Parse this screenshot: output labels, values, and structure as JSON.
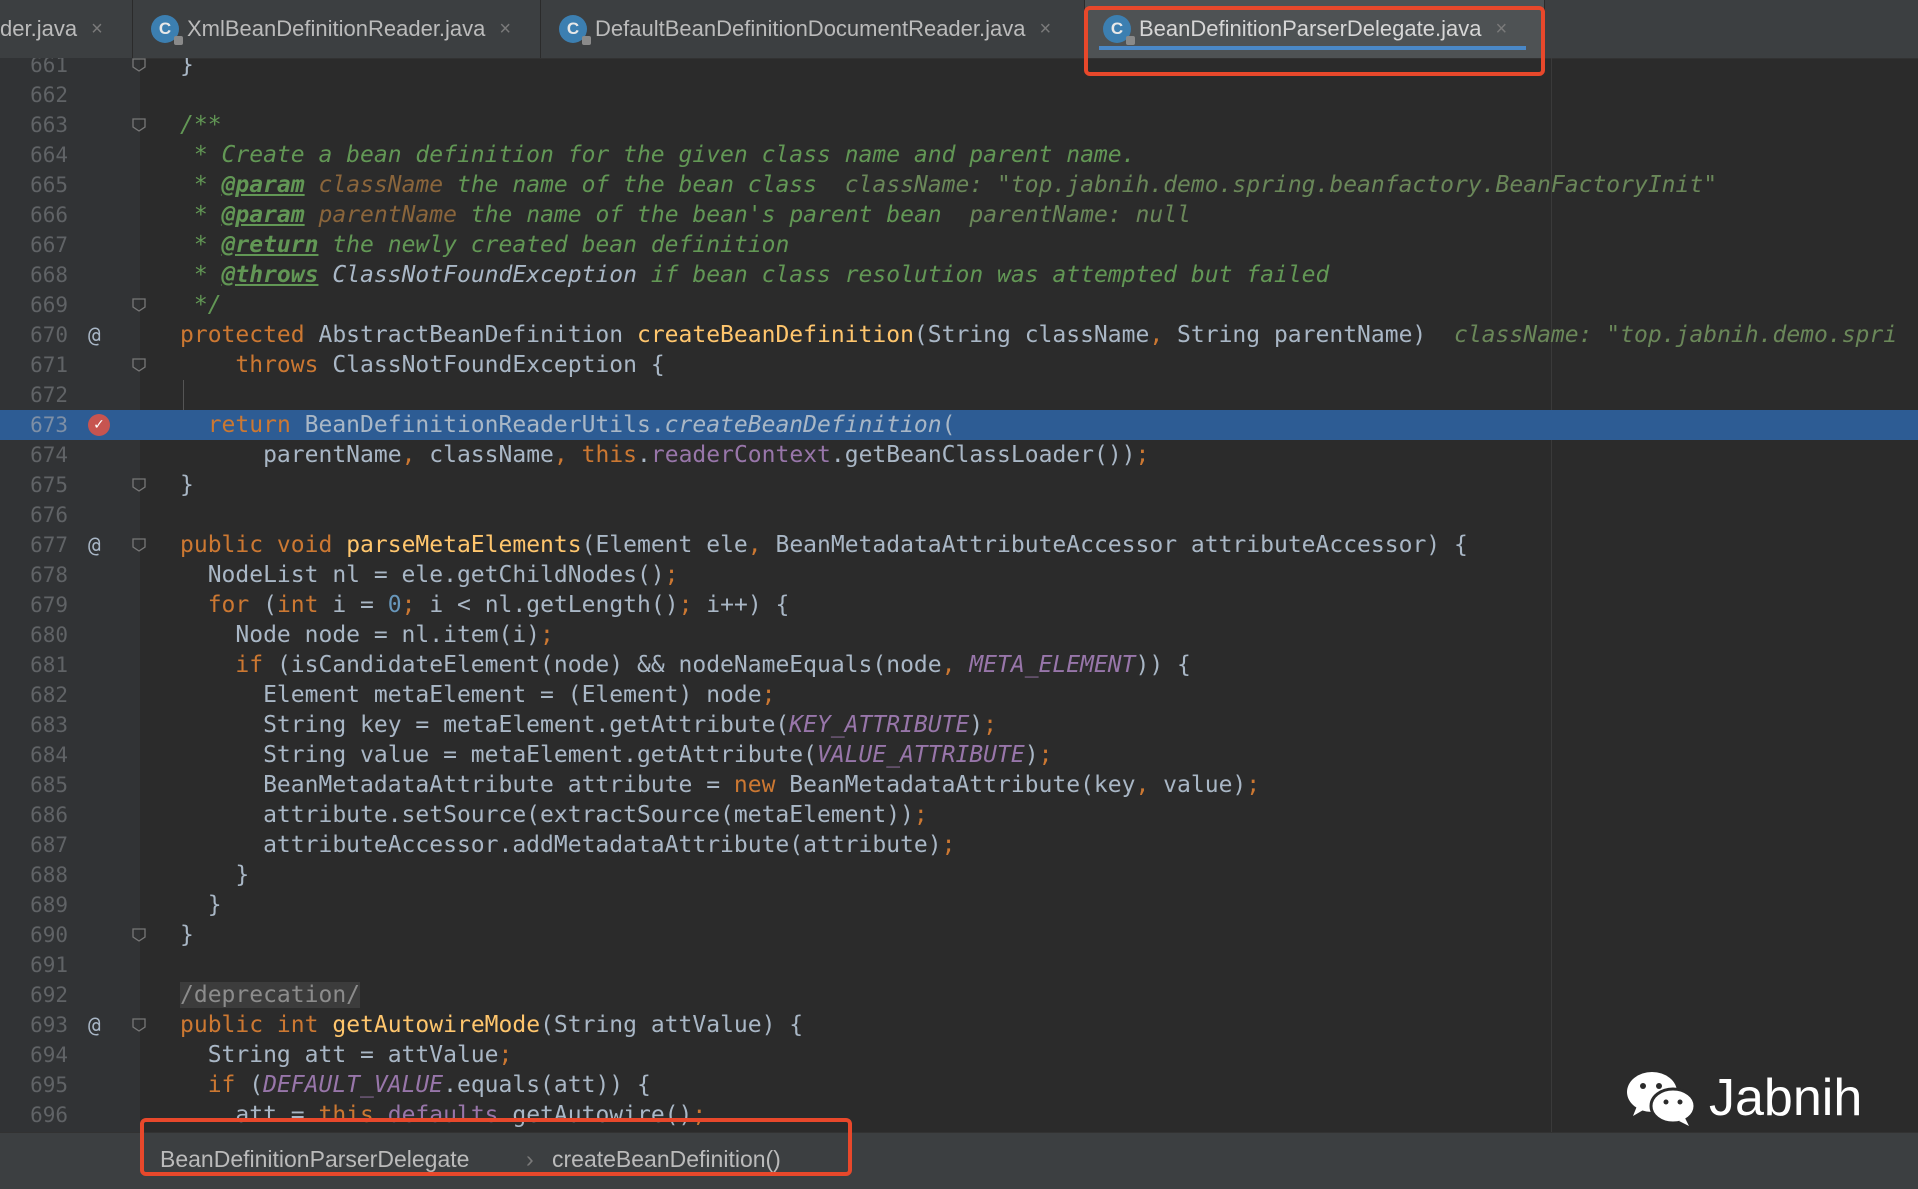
{
  "tabs": [
    {
      "label": "der.java",
      "active": false
    },
    {
      "label": "XmlBeanDefinitionReader.java",
      "active": false
    },
    {
      "label": "DefaultBeanDefinitionDocumentReader.java",
      "active": false
    },
    {
      "label": "BeanDefinitionParserDelegate.java",
      "active": true
    }
  ],
  "tab_icon_letter": "C",
  "close_glyph": "×",
  "code": {
    "line_numbers": [
      "661",
      "662",
      "663",
      "664",
      "665",
      "666",
      "667",
      "668",
      "669",
      "670",
      "671",
      "672",
      "673",
      "674",
      "675",
      "676",
      "677",
      "678",
      "679",
      "680",
      "681",
      "682",
      "683",
      "684",
      "685",
      "686",
      "687",
      "688",
      "689",
      "690",
      "691",
      "692",
      "693",
      "694",
      "695",
      "696"
    ],
    "executing_line": "673",
    "breakpoint_line": "673",
    "override_marker": "@",
    "inline_hints": {
      "l665": "className: \"top.jabnih.demo.spring.beanfactory.BeanFactoryInit\"",
      "l666": "parentName: null",
      "l670": "className: \"top.jabnih.demo.spri"
    },
    "deprecation_tag": "/deprecation/"
  },
  "breadcrumb": {
    "class": "BeanDefinitionParserDelegate",
    "method": "createBeanDefinition()",
    "separator": "›"
  },
  "watermark": {
    "label": "Jabnih",
    "icon": "wechat-icon"
  },
  "colors": {
    "background": "#2b2b2b",
    "gutter": "#313335",
    "keyword": "#cc7832",
    "comment": "#629755",
    "function": "#ffc66d",
    "constant": "#9876aa",
    "execution_line": "#2d5c94",
    "highlight_box": "#e8482b"
  }
}
